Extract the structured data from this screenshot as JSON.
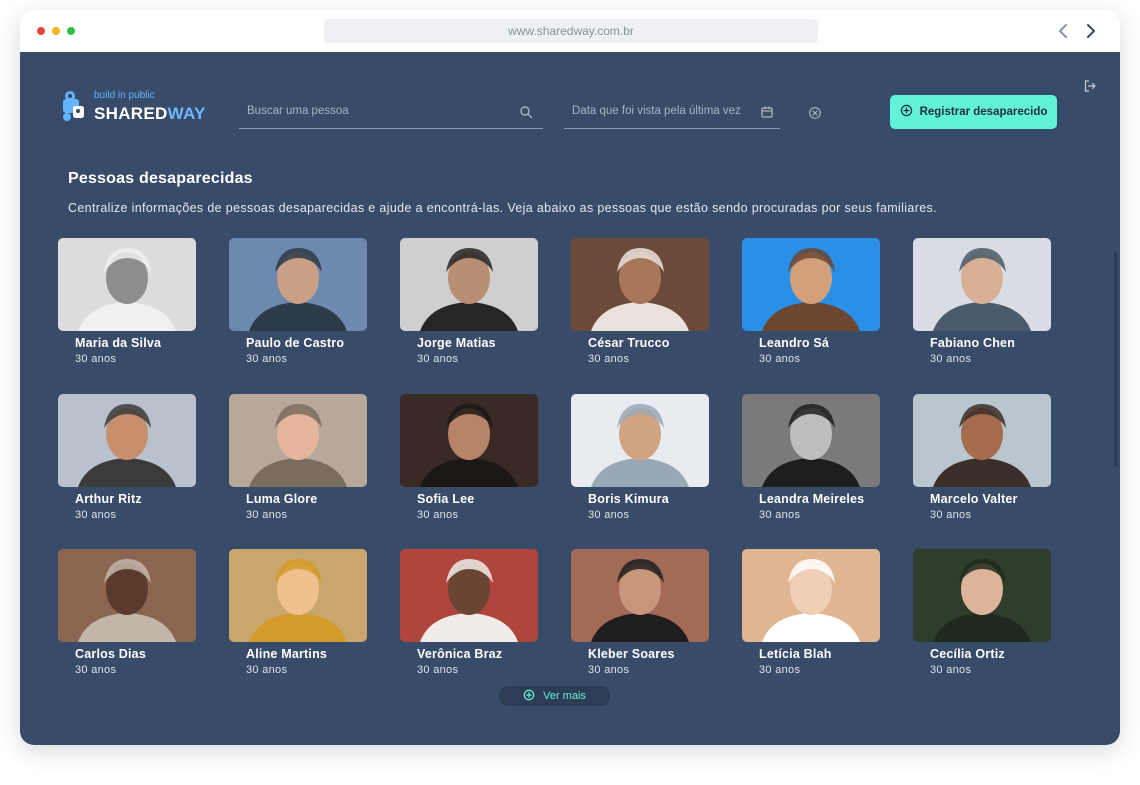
{
  "browser": {
    "url": "www.sharedway.com.br"
  },
  "brand": {
    "tagline": "build in public",
    "word_main": "SHARED",
    "word_accent": "WAY"
  },
  "search": {
    "placeholder": "Buscar uma pessoa"
  },
  "date_filter": {
    "placeholder": "Data que foi vista pela última vez"
  },
  "register_button": {
    "label": "Registrar desaparecido"
  },
  "section": {
    "title": "Pessoas desaparecidas",
    "description": "Centralize informações de pessoas desaparecidas e ajude a encontrá-las. Veja abaixo as pessoas que estão sendo procuradas por seus familiares."
  },
  "people": [
    {
      "name": "Maria da Silva",
      "age": "30 anos"
    },
    {
      "name": "Paulo de Castro",
      "age": "30 anos"
    },
    {
      "name": "Jorge Matias",
      "age": "30 anos"
    },
    {
      "name": "César Trucco",
      "age": "30 anos"
    },
    {
      "name": "Leandro Sá",
      "age": "30 anos"
    },
    {
      "name": "Fabiano Chen",
      "age": "30 anos"
    },
    {
      "name": "Arthur Ritz",
      "age": "30 anos"
    },
    {
      "name": "Luma Glore",
      "age": "30 anos"
    },
    {
      "name": "Sofia Lee",
      "age": "30 anos"
    },
    {
      "name": "Boris Kimura",
      "age": "30 anos"
    },
    {
      "name": "Leandra Meireles",
      "age": "30 anos"
    },
    {
      "name": "Marcelo Valter",
      "age": "30 anos"
    },
    {
      "name": "Carlos Dias",
      "age": "30 anos"
    },
    {
      "name": "Aline Martins",
      "age": "30 anos"
    },
    {
      "name": "Verônica Braz",
      "age": "30 anos"
    },
    {
      "name": "Kleber Soares",
      "age": "30 anos"
    },
    {
      "name": "Letícia Blah",
      "age": "30 anos"
    },
    {
      "name": "Cecília Ortiz",
      "age": "30 anos"
    }
  ],
  "more_button": {
    "label": "Ver mais"
  },
  "icons": {
    "logo": "sharedway-logo-icon",
    "search": "search-icon",
    "calendar": "calendar-icon",
    "clear": "clear-circle-icon",
    "add": "plus-circle-icon",
    "logout": "logout-icon",
    "back": "chevron-left-icon",
    "forward": "chevron-right-icon"
  },
  "colors": {
    "background": "#384b69",
    "accent": "#62f2d7",
    "brand_blue": "#6fb7ff"
  }
}
